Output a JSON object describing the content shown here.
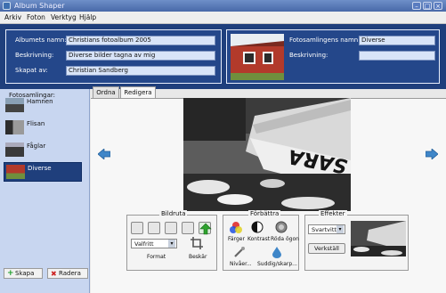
{
  "window": {
    "title": "Album Shaper"
  },
  "menu": [
    "Arkiv",
    "Foton",
    "Verktyg",
    "Hjälp"
  ],
  "album": {
    "name_label": "Albumets namn:",
    "name_value": "Christians fotoalbum 2005",
    "desc_label": "Beskrivning:",
    "desc_value": "Diverse bilder tagna av mig",
    "creator_label": "Skapat av:",
    "creator_value": "Christian Sandberg"
  },
  "collection": {
    "name_label": "Fotosamlingens namn:",
    "name_value": "Diverse",
    "desc_label": "Beskrivning:",
    "desc_value": ""
  },
  "sidebar": {
    "title": "Fotosamlingar:",
    "items": [
      {
        "label": "Hamnen"
      },
      {
        "label": "Flisan"
      },
      {
        "label": "Fåglar"
      },
      {
        "label": "Diverse",
        "selected": true
      }
    ],
    "create_button": "Skapa",
    "delete_button": "Radera"
  },
  "tabs": [
    {
      "label": "Ordna",
      "active": false
    },
    {
      "label": "Redigera",
      "active": true
    }
  ],
  "photo": {
    "boat_text": "SARA"
  },
  "frame_group": {
    "title": "Bildruta",
    "format_value": "Valfritt",
    "format_label": "Format",
    "crop_label": "Beskär"
  },
  "enhance_group": {
    "title": "Förbättra",
    "colors_label": "Färger",
    "contrast_label": "Kontrast",
    "redeye_label": "Röda ögon",
    "levels_label": "Nivåer...",
    "sharpen_label": "Suddig/skarp..."
  },
  "effects_group": {
    "title": "Effekter",
    "effect_value": "Svartvitt",
    "apply_button": "Verkställ"
  },
  "colors": {
    "header_bg": "#1f3f7c",
    "selection": "#1f3f7c",
    "sidebar_bg": "#c8d6f0"
  }
}
